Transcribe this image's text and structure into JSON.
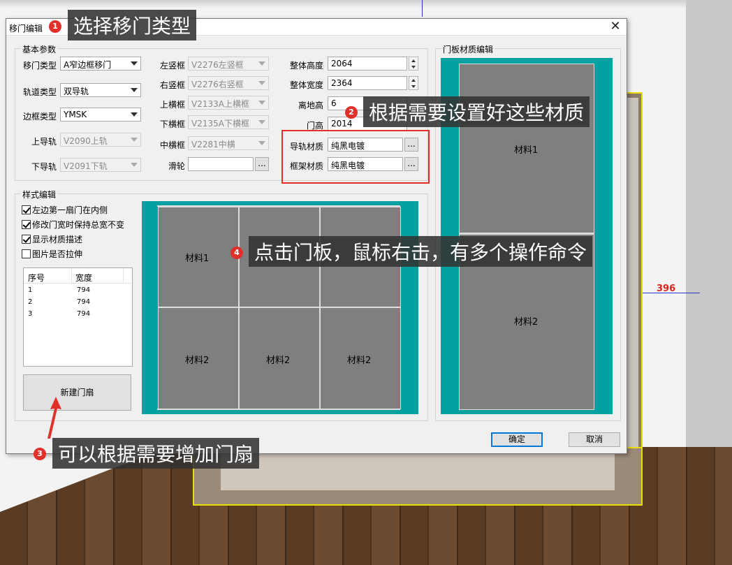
{
  "scene": {
    "dimension_label": "396"
  },
  "dialog": {
    "title": "移门编辑",
    "close": "✕",
    "basic": {
      "group_label": "基本参数",
      "door_type_label": "移门类型",
      "door_type_value": "A窄边框移门",
      "track_type_label": "轨道类型",
      "track_type_value": "双导轨",
      "frame_type_label": "边框类型",
      "frame_type_value": "YMSK",
      "upper_rail_label": "上导轨",
      "upper_rail_value": "V2090上轨",
      "lower_rail_label": "下导轨",
      "lower_rail_value": "V2091下轨",
      "left_stile_label": "左竖框",
      "left_stile_value": "V2276左竖框",
      "right_stile_label": "右竖框",
      "right_stile_value": "V2276右竖框",
      "top_rail_label": "上横框",
      "top_rail_value": "V2133A上横框",
      "bottom_rail_label": "下横框",
      "bottom_rail_value": "V2135A下横框",
      "mid_rail_label": "中横框",
      "mid_rail_value": "V2281中横",
      "pulley_label": "滑轮",
      "pulley_value": "",
      "pulley_btn": "...",
      "height_label": "整体高度",
      "height_value": "2064",
      "width_label": "整体宽度",
      "width_value": "2364",
      "ground_label": "离地高",
      "ground_value": "6",
      "door_height_label": "门高",
      "door_height_value": "2014",
      "rail_material_label": "导轨材质",
      "rail_material_value": "纯黑电镀",
      "rail_material_btn": "...",
      "frame_material_label": "框架材质",
      "frame_material_value": "纯黑电镀",
      "frame_material_btn": "..."
    },
    "style": {
      "group_label": "样式编辑",
      "checks": [
        {
          "label": "左边第一扇门在内侧",
          "checked": true
        },
        {
          "label": "修改门宽时保持总宽不变",
          "checked": true
        },
        {
          "label": "显示材质描述",
          "checked": true
        },
        {
          "label": "图片是否拉伸",
          "checked": false
        }
      ],
      "list_headers": [
        "序号",
        "宽度"
      ],
      "rows": [
        {
          "no": "1",
          "width": "794"
        },
        {
          "no": "2",
          "width": "794"
        },
        {
          "no": "3",
          "width": "794"
        }
      ],
      "new_door_btn": "新建门扇",
      "preview": {
        "material1": "材料1",
        "material2": "材料2"
      }
    },
    "panel_material": {
      "group_label": "门板材质编辑",
      "material1": "材料1",
      "material2": "材料2"
    },
    "ok_btn": "确定",
    "cancel_btn": "取消"
  },
  "callouts": {
    "c1": {
      "num": "1",
      "text": "选择移门类型"
    },
    "c2": {
      "num": "2",
      "text": "根据需要设置好这些材质"
    },
    "c3": {
      "num": "3",
      "text": "可以根据需要增加门扇"
    },
    "c4": {
      "num": "4",
      "text": "点击门板，鼠标右击，有多个操作命令"
    }
  }
}
